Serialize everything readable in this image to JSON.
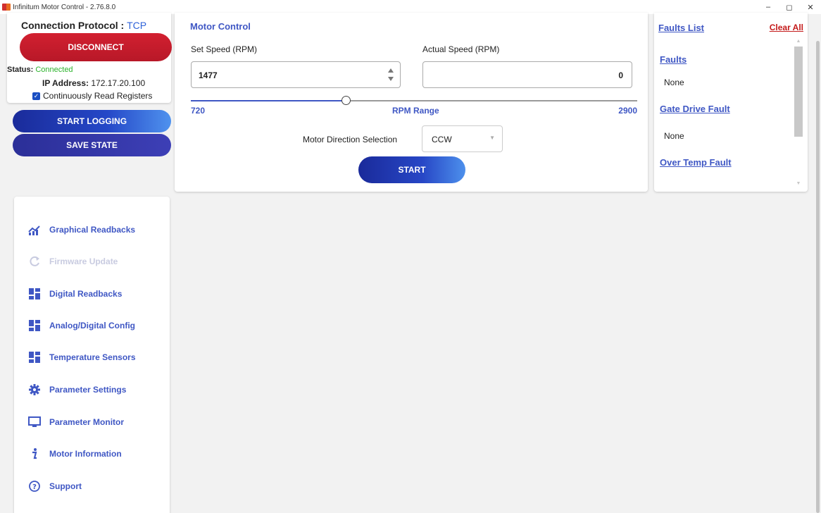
{
  "window": {
    "title": "Infinitum Motor Control - 2.76.8.0",
    "controls": [
      "–",
      "◻",
      "✕"
    ]
  },
  "connection": {
    "protocol_label": "Connection Protocol :",
    "protocol_value": "TCP",
    "disconnect_label": "DISCONNECT",
    "status_label": "Status:",
    "status_value": "Connected",
    "ip_label": "IP Address:",
    "ip_value": "172.17.20.100",
    "continuous_read_label": "Continuously Read Registers",
    "continuous_read_checked": true
  },
  "actions": {
    "start_logging": "START LOGGING",
    "save_state": "SAVE STATE"
  },
  "motor_control": {
    "title": "Motor Control",
    "set_speed_label": "Set Speed (RPM)",
    "set_speed_value": "1477",
    "actual_speed_label": "Actual Speed (RPM)",
    "actual_speed_value": "0",
    "range_min": "720",
    "range_max": "2900",
    "range_label": "RPM Range",
    "slider_value": 1477,
    "direction_label": "Motor Direction Selection",
    "direction_value": "CCW",
    "start_label": "START",
    "accent_color": "#3f57c4"
  },
  "faults": {
    "title": "Faults List",
    "clear_all": "Clear All",
    "sections": [
      {
        "title": "Faults",
        "value": "None"
      },
      {
        "title": "Gate Drive Fault",
        "value": "None"
      },
      {
        "title": "Over Temp Fault"
      }
    ]
  },
  "nav": {
    "items": [
      {
        "label": "Graphical Readbacks",
        "icon": "chart-icon",
        "enabled": true
      },
      {
        "label": "Firmware Update",
        "icon": "refresh-icon",
        "enabled": false
      },
      {
        "label": "Digital Readbacks",
        "icon": "dashboard-icon",
        "enabled": true
      },
      {
        "label": "Analog/Digital Config",
        "icon": "dashboard-icon",
        "enabled": true
      },
      {
        "label": "Temperature Sensors",
        "icon": "dashboard-icon",
        "enabled": true
      },
      {
        "label": "Parameter Settings",
        "icon": "gear-icon",
        "enabled": true
      },
      {
        "label": "Parameter Monitor",
        "icon": "monitor-icon",
        "enabled": true
      },
      {
        "label": "Motor Information",
        "icon": "info-icon",
        "enabled": true
      },
      {
        "label": "Support",
        "icon": "help-icon",
        "enabled": true
      }
    ]
  }
}
